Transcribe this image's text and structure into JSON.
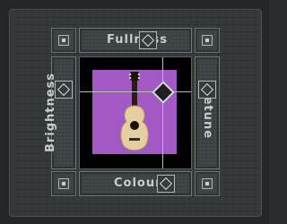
{
  "controls": {
    "top_label": "Fullness",
    "bottom_label": "Colour",
    "left_label": "Brightness",
    "right_label": "Detune"
  },
  "image": {
    "subject_icon": "acoustic-guitar-icon"
  },
  "colors": {
    "background": "#242728",
    "panel": "#3b4041",
    "viewport": "#a259c4",
    "accent_text": "#c7cccd"
  }
}
